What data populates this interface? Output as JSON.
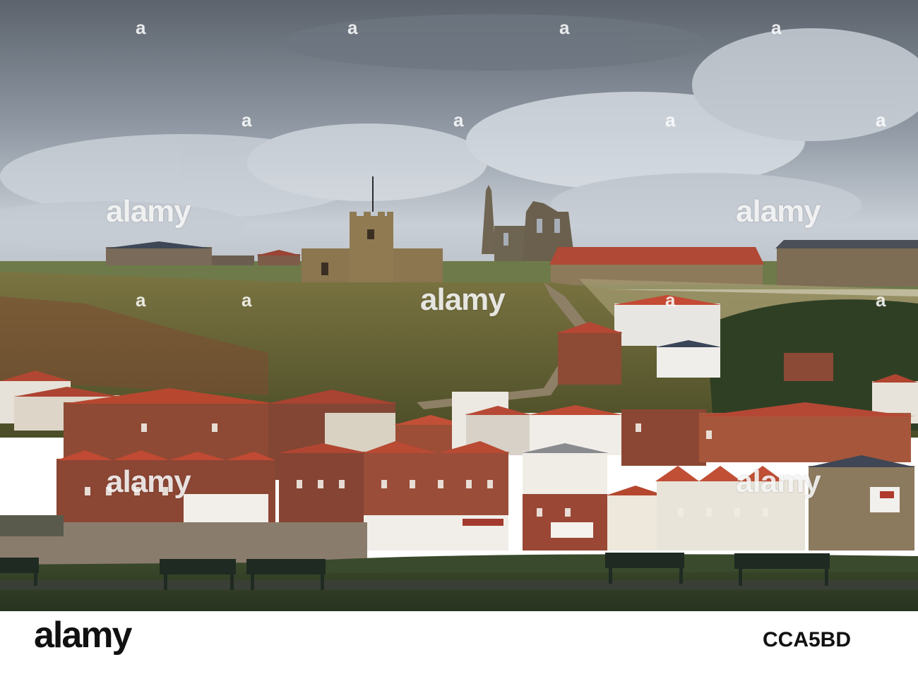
{
  "watermark": {
    "brand": "alamy",
    "tile": "a"
  },
  "footer": {
    "logo_text": "alamy",
    "image_id": "CCA5BD"
  },
  "scene_colors": {
    "sky_top": "#5f6670",
    "sky_mid": "#9aa3ad",
    "cloud": "#d8dde3",
    "hill": "#5a5a2c",
    "roof_red": "#b4452f",
    "brick": "#8a4a32",
    "grass": "#2f3a24"
  }
}
